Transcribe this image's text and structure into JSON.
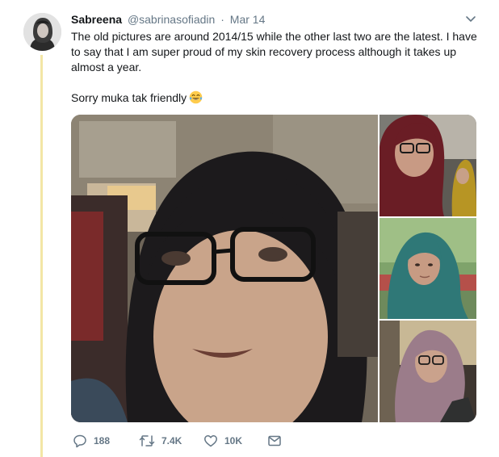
{
  "tweet": {
    "author": {
      "display_name": "Sabreena",
      "handle": "@sabrinasofiadin",
      "avatar": "avatar-photo"
    },
    "separator": "·",
    "timestamp": "Mar 14",
    "text": [
      "The old pictures are around 2014/15 while the other last two are the latest. I have to say that I am super proud of my skin recovery process although it takes up almost a year.",
      "Sorry muka tak friendly"
    ],
    "emoji": "face-with-tears-of-joy",
    "media": [
      {
        "name": "photo-old-selfie-black-hijab"
      },
      {
        "name": "photo-maroon-hijab-glasses"
      },
      {
        "name": "photo-teal-hijab-outdoor"
      },
      {
        "name": "photo-mauve-hijab-glasses"
      }
    ],
    "actions": {
      "replies": "188",
      "retweets": "7.4K",
      "likes": "10K",
      "icons": [
        "reply-icon",
        "retweet-icon",
        "like-icon",
        "direct-message-icon"
      ]
    },
    "menu_icon": "chevron-down-icon"
  },
  "colors": {
    "text_primary": "#14171a",
    "text_secondary": "#657786",
    "thread_line": "#f3e6a6"
  }
}
